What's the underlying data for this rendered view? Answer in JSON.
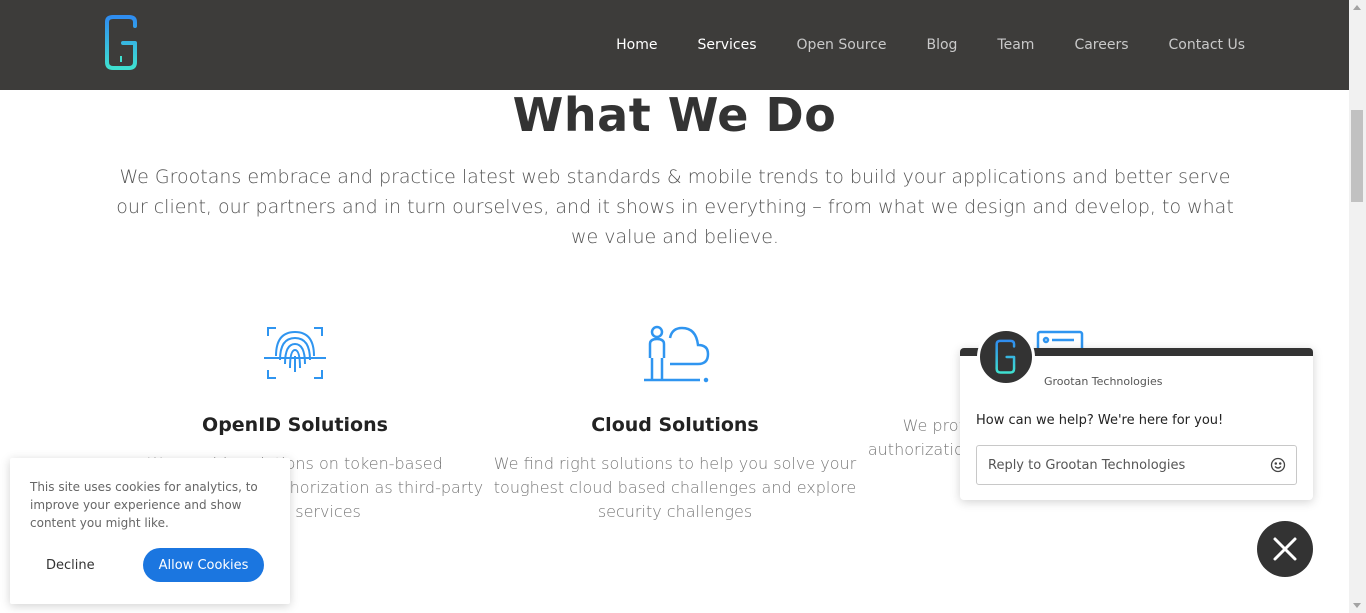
{
  "header": {
    "logo_icon": "grootan-logo-icon",
    "nav": [
      {
        "label": "Home",
        "active": true
      },
      {
        "label": "Services",
        "active": true
      },
      {
        "label": "Open Source",
        "active": false
      },
      {
        "label": "Blog",
        "active": false
      },
      {
        "label": "Team",
        "active": false
      },
      {
        "label": "Careers",
        "active": false
      },
      {
        "label": "Contact Us",
        "active": false
      }
    ]
  },
  "section": {
    "title": "What We Do",
    "description": "We Grootans embrace and practice latest web standards & mobile trends to build your applications and better serve our client, our partners and in turn ourselves, and it shows in everything – from what we design and develop, to what we value and believe."
  },
  "cards": [
    {
      "icon": "fingerprint-icon",
      "title": "OpenID Solutions",
      "text": "We provide solutions on token-based authentication and authorization as third-party identity services"
    },
    {
      "icon": "cloud-person-icon",
      "title": "Cloud Solutions",
      "text": "We find right solutions to help you solve your toughest cloud based challenges and explore security challenges"
    },
    {
      "icon": "payment-card-icon",
      "title": "",
      "text": "We provide secure authentication and authorization and make your payments secure"
    }
  ],
  "cookie": {
    "message": "This site uses cookies for analytics, to improve your experience and show content you might like.",
    "decline_label": "Decline",
    "allow_label": "Allow Cookies"
  },
  "chat": {
    "company": "Grootan Technologies",
    "greeting": "How can we help? We're here for you!",
    "reply_placeholder": "Reply to Grootan Technologies",
    "emoji_icon": "smiley-icon",
    "close_icon": "close-icon"
  },
  "colors": {
    "header_bg": "#3d3c3a",
    "accent_blue": "#1b76e0",
    "icon_blue": "#2f95f0",
    "logo_gradient_start": "#2f8df0",
    "logo_gradient_end": "#3fe0d0"
  }
}
